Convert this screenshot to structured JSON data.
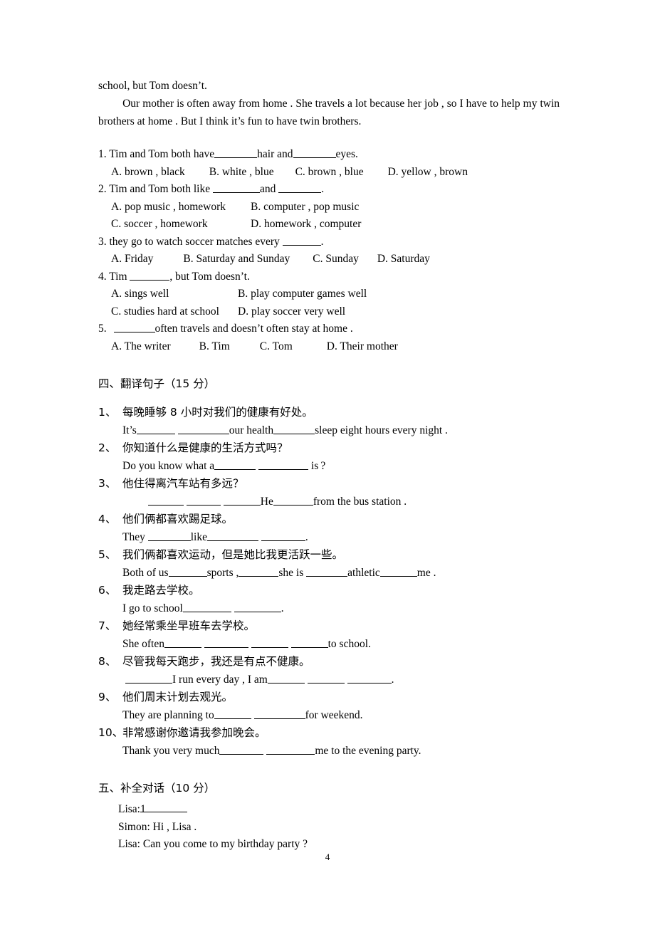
{
  "document": {
    "page_number": "4"
  },
  "passage": {
    "line1": "school, but Tom doesn’t.",
    "line2": "Our mother is often away from home . She travels a lot because her job , so I have to help my twin brothers at home . But I think it’s fun to have twin brothers."
  },
  "multiple_choice": [
    {
      "number": "1.",
      "stem_a": "Tim and Tom both have",
      "stem_b": "hair and",
      "stem_c": "eyes.",
      "options_row1": [
        "A. brown , black",
        "B. white , blue",
        "C. brown , blue",
        "D. yellow , brown"
      ]
    },
    {
      "number": "2.",
      "stem_a": "Tim and Tom both like",
      "stem_b": "and",
      "stem_c": ".",
      "options_row1": [
        "A. pop music , homework",
        "B. computer , pop music"
      ],
      "options_row2": [
        "C. soccer , homework",
        "D. homework , computer"
      ]
    },
    {
      "number": "3.",
      "stem_a": "they go to watch soccer matches every",
      "stem_b": ".",
      "options_row1": [
        "A. Friday",
        "B. Saturday and Sunday",
        "C. Sunday",
        "D. Saturday"
      ]
    },
    {
      "number": "4.",
      "stem_a": "Tim",
      "stem_b": ", but Tom doesn’t.",
      "options_row1": [
        "A. sings well",
        "B. play computer games well"
      ],
      "options_row2": [
        "C. studies hard at school",
        "D. play soccer very well"
      ]
    },
    {
      "number": "5.",
      "stem_a": "",
      "stem_b": "often travels and doesn’t often stay at home .",
      "options_row1": [
        "A. The writer",
        "B. Tim",
        "C. Tom",
        "D. Their mother"
      ]
    }
  ],
  "section_four": {
    "heading": "四、翻译句子（15 分）",
    "items": [
      {
        "number": "1、",
        "chinese": "每晚睡够 8 小时对我们的健康有好处。",
        "english_parts": [
          "It’s",
          "",
          "our health",
          "sleep eight hours every night ."
        ]
      },
      {
        "number": "2、",
        "chinese": "你知道什么是健康的生活方式吗？",
        "english_parts": [
          "Do you know what a",
          "",
          "is ?"
        ]
      },
      {
        "number": "3、",
        "chinese": "他住得离汽车站有多远？",
        "english_parts": [
          "",
          "",
          "He",
          "from the bus station ."
        ]
      },
      {
        "number": "4、",
        "chinese": "他们俩都喜欢踢足球。",
        "english_parts": [
          "They",
          "like",
          "",
          "."
        ]
      },
      {
        "number": "5、",
        "chinese": "我们俩都喜欢运动，但是她比我更活跃一些。",
        "english_parts": [
          "Both of us",
          "sports ,",
          "she is",
          "athletic",
          "me ."
        ]
      },
      {
        "number": "6、",
        "chinese": "我走路去学校。",
        "english_parts": [
          "I go to school",
          "",
          "."
        ]
      },
      {
        "number": "7、",
        "chinese": "她经常乘坐早班车去学校。",
        "english_parts": [
          "She often",
          "",
          "",
          "to school."
        ]
      },
      {
        "number": "8、",
        "chinese": "尽管我每天跑步，我还是有点不健康。",
        "english_parts": [
          "",
          "I run every day , I am",
          "",
          "",
          "."
        ]
      },
      {
        "number": "9、",
        "chinese": "他们周末计划去观光。",
        "english_parts": [
          "They are planning to",
          "",
          "for weekend."
        ]
      },
      {
        "number": "10、",
        "chinese": "非常感谢你邀请我参加晚会。",
        "english_parts": [
          "Thank you very much",
          "",
          "me to the evening party."
        ]
      }
    ]
  },
  "section_five": {
    "heading": "五、补全对话（10 分）",
    "dialogue": [
      {
        "speaker": "Lisa:",
        "text": "1",
        "blank_after": true
      },
      {
        "speaker": "Simon:",
        "text": "Hi , Lisa .",
        "blank_after": false
      },
      {
        "speaker": "Lisa:",
        "text": "Can you come to my birthday party ?",
        "blank_after": false
      }
    ]
  }
}
